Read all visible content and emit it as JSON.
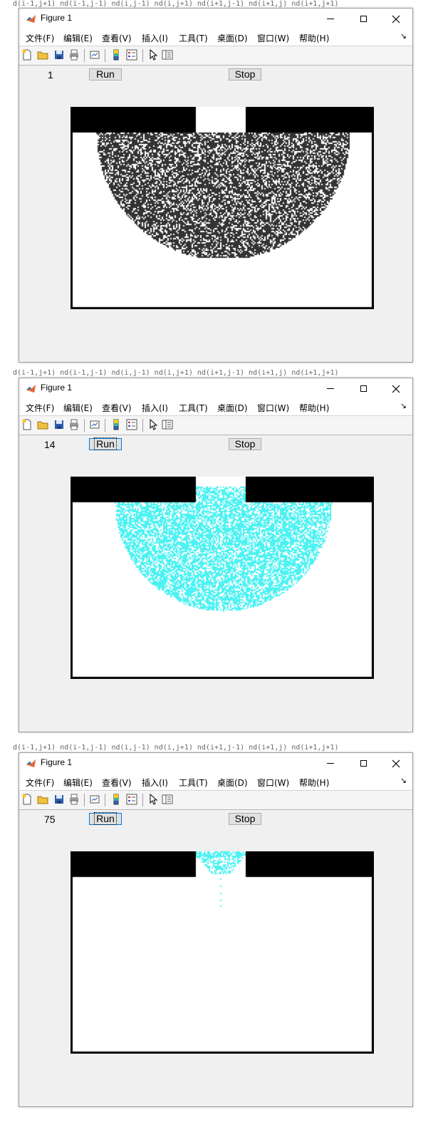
{
  "background_code_text": "d(i-1,j+1)  nd(i-1,j-1)  nd(i,j-1)  nd(i,j+1)  nd(i+1,j-1)  nd(i+1,j)  nd(i+1,j+1)",
  "figure": {
    "title": "Figure 1",
    "menus": [
      "文件(F)",
      "编辑(E)",
      "查看(V)",
      "插入(I)",
      "工具(T)",
      "桌面(D)",
      "窗口(W)",
      "帮助(H)"
    ],
    "toolbar_icons": [
      "new-figure-icon",
      "open-file-icon",
      "save-icon",
      "print-icon",
      "link-plot-icon",
      "colorbar-icon",
      "legend-icon",
      "pointer-icon",
      "property-editor-icon"
    ],
    "run_label": "Run",
    "stop_label": "Stop"
  },
  "windows": [
    {
      "counter": "1",
      "particle_color": "#333333",
      "state": "full-hemisphere"
    },
    {
      "counter": "14",
      "particle_color": "#4df2f2",
      "state": "hemisphere-rising"
    },
    {
      "counter": "75",
      "particle_color": "#4df2f2",
      "state": "escaping-through-gap"
    }
  ],
  "colors": {
    "window_bg": "#f0f0f0",
    "plot_bg": "#ffffff",
    "wall": "#000000",
    "accent_focus": "#0078d7"
  }
}
